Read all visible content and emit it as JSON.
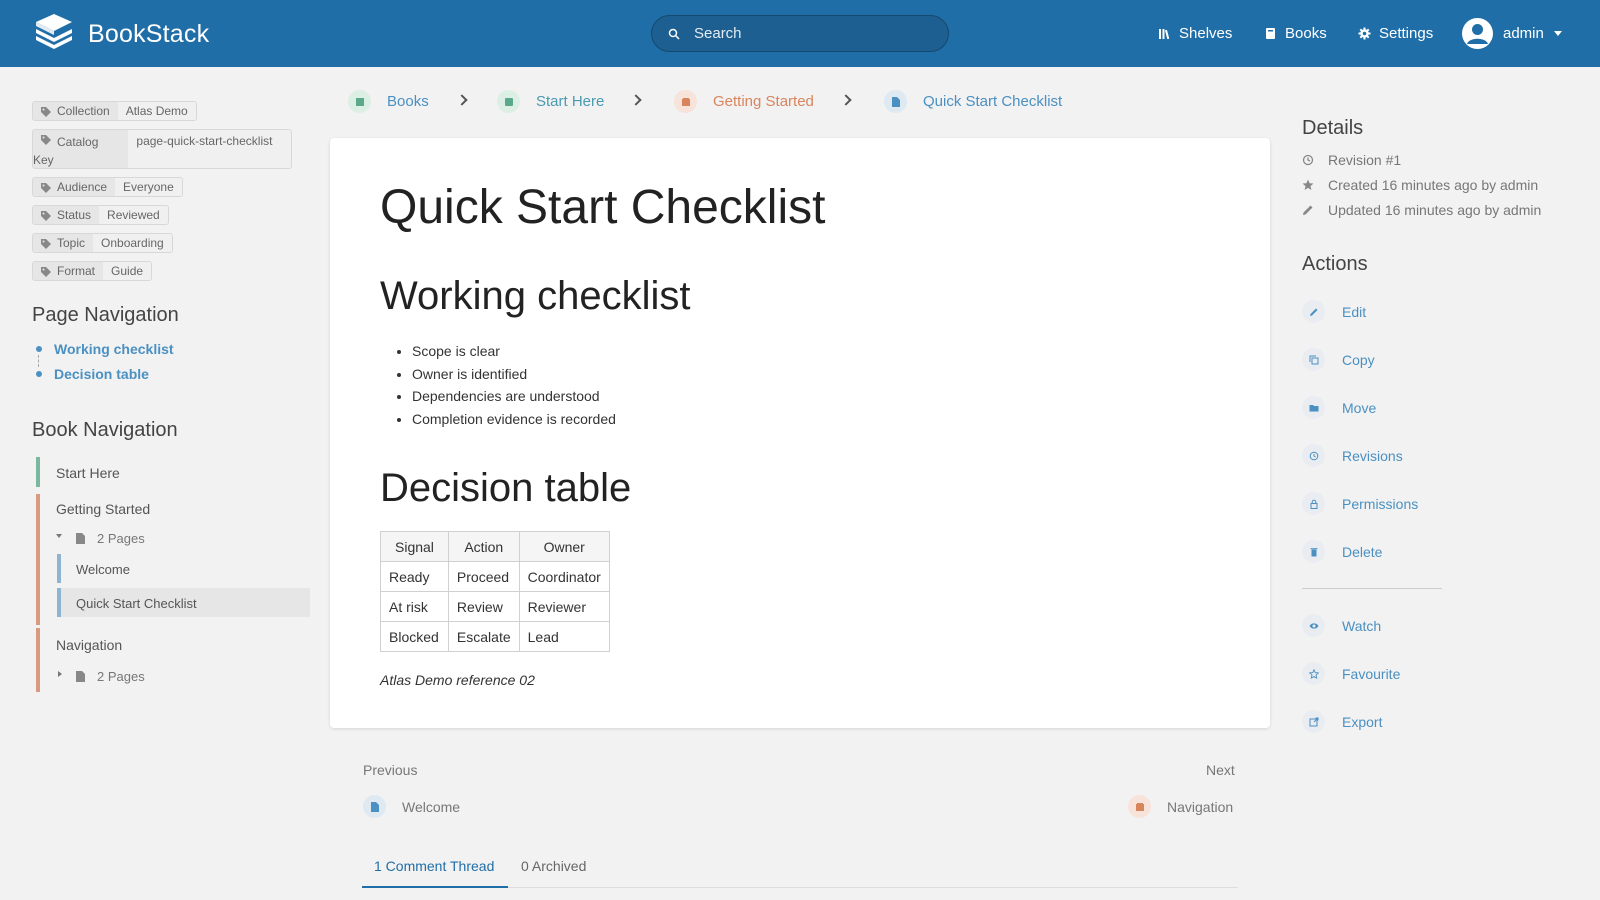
{
  "header": {
    "app_name": "BookStack",
    "search_placeholder": "Search",
    "nav": [
      {
        "label": "Shelves",
        "icon": "shelves-icon"
      },
      {
        "label": "Books",
        "icon": "books-icon"
      },
      {
        "label": "Settings",
        "icon": "gear-icon"
      }
    ],
    "user": "admin"
  },
  "tags": [
    {
      "name": "Collection",
      "value": "Atlas Demo"
    },
    {
      "name": "Catalog Key",
      "value": "page-quick-start-checklist"
    },
    {
      "name": "Audience",
      "value": "Everyone"
    },
    {
      "name": "Status",
      "value": "Reviewed"
    },
    {
      "name": "Topic",
      "value": "Onboarding"
    },
    {
      "name": "Format",
      "value": "Guide"
    }
  ],
  "page_navigation": {
    "title": "Page Navigation",
    "items": [
      "Working checklist",
      "Decision table"
    ]
  },
  "book_navigation": {
    "title": "Book Navigation",
    "items": {
      "start_here": "Start Here",
      "getting_started": "Getting Started",
      "gs_pages": "2 Pages",
      "welcome": "Welcome",
      "quick_start": "Quick Start Checklist",
      "navigation": "Navigation",
      "nav_pages": "2 Pages"
    }
  },
  "breadcrumbs": [
    "Books",
    "Start Here",
    "Getting Started",
    "Quick Start Checklist"
  ],
  "content": {
    "title": "Quick Start Checklist",
    "section1": "Working checklist",
    "checklist": [
      "Scope is clear",
      "Owner is identified",
      "Dependencies are understood",
      "Completion evidence is recorded"
    ],
    "section2": "Decision table",
    "table": {
      "headers": [
        "Signal",
        "Action",
        "Owner"
      ],
      "rows": [
        [
          "Ready",
          "Proceed",
          "Coordinator"
        ],
        [
          "At risk",
          "Review",
          "Reviewer"
        ],
        [
          "Blocked",
          "Escalate",
          "Lead"
        ]
      ]
    },
    "reference": "Atlas Demo reference 02"
  },
  "prev_next": {
    "previous_label": "Previous",
    "previous_item": "Welcome",
    "next_label": "Next",
    "next_item": "Navigation"
  },
  "comments": {
    "tab_active": "1 Comment Thread",
    "tab_archived": "0 Archived"
  },
  "details": {
    "title": "Details",
    "revision": "Revision #1",
    "created": "Created 16 minutes ago by admin",
    "updated": "Updated 16 minutes ago by admin"
  },
  "actions": {
    "title": "Actions",
    "items": [
      "Edit",
      "Copy",
      "Move",
      "Revisions",
      "Permissions",
      "Delete"
    ],
    "secondary": [
      "Watch",
      "Favourite",
      "Export"
    ]
  },
  "colors": {
    "header": "#206ea7",
    "link": "#4a90c2",
    "book": "#7bd06e",
    "chapter": "#e07a4f",
    "page": "#4a90c2"
  }
}
